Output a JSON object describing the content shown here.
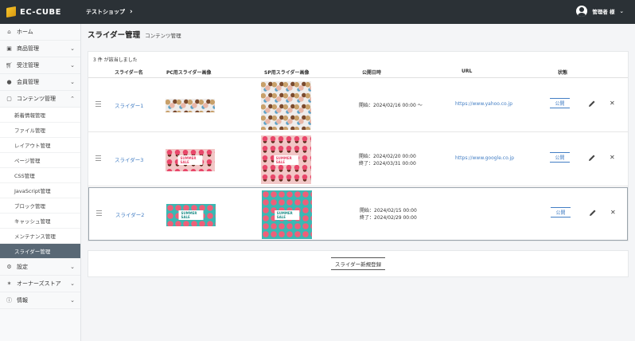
{
  "header": {
    "brand": "EC-CUBE",
    "shop_name": "テストショップ",
    "user_name": "管理者 様"
  },
  "sidebar": {
    "items": [
      {
        "label": "ホーム",
        "icon": "home-icon"
      },
      {
        "label": "商品管理",
        "icon": "cube-icon"
      },
      {
        "label": "受注管理",
        "icon": "cart-icon"
      },
      {
        "label": "会員管理",
        "icon": "users-icon"
      },
      {
        "label": "コンテンツ管理",
        "icon": "document-icon"
      }
    ],
    "content_subitems": [
      "新着情報管理",
      "ファイル管理",
      "レイアウト管理",
      "ページ管理",
      "CSS管理",
      "JavaScript管理",
      "ブロック管理",
      "キャッシュ管理",
      "メンテナンス管理",
      "スライダー管理"
    ],
    "bottom_items": [
      {
        "label": "設定",
        "icon": "gear-icon"
      },
      {
        "label": "オーナーズストア",
        "icon": "store-icon"
      },
      {
        "label": "情報",
        "icon": "info-icon"
      }
    ]
  },
  "page": {
    "title": "スライダー管理",
    "subtitle": "コンテンツ管理",
    "result_text": "3 件 が該当しました"
  },
  "table": {
    "headers": [
      "スライダー名",
      "PC用スライダー画像",
      "SP用スライダー画像",
      "公開日時",
      "URL",
      "状態"
    ],
    "rows": [
      {
        "name": "スライダー1",
        "date": "開始：2024/02/16 00:00 ～",
        "url": "https://www.yahoo.co.jp",
        "status": "公開",
        "banner": ""
      },
      {
        "name": "スライダー3",
        "date": "開始：2024/02/20 00:00\n終了：2024/03/31 00:00",
        "url": "https://www.google.co.jp",
        "status": "公開",
        "banner": "SUMMER SALE"
      },
      {
        "name": "スライダー2",
        "date": "開始：2024/02/15 00:00\n終了：2024/02/29 00:00",
        "url": "",
        "status": "公開",
        "banner": "SUMMER SALE"
      }
    ]
  },
  "actions": {
    "new_button": "スライダー新規登録"
  },
  "colors": {
    "header_bg": "#2b3136",
    "link": "#437ec4",
    "active_nav": "#596875"
  }
}
